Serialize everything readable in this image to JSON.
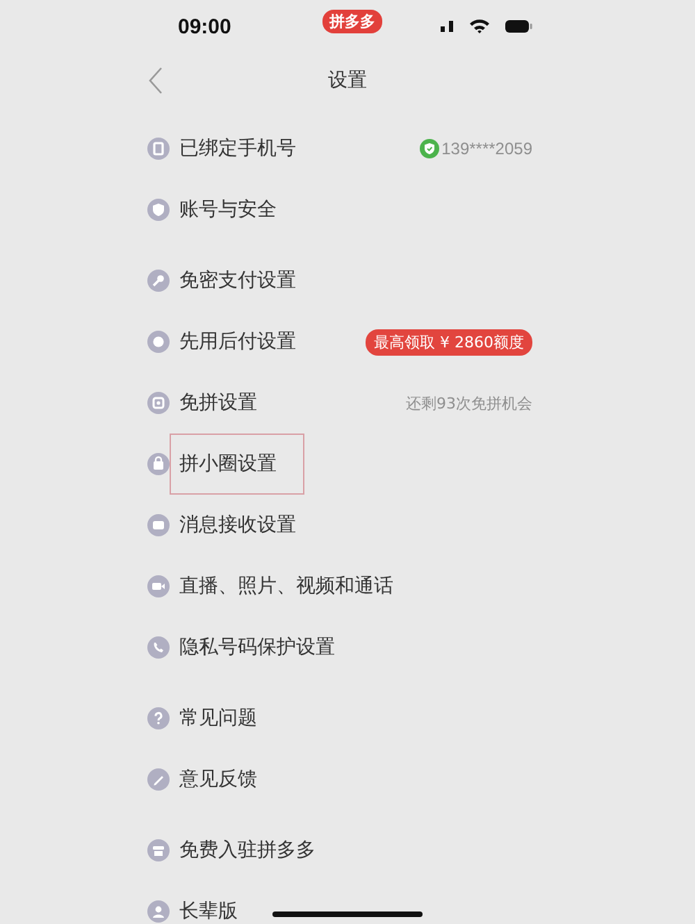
{
  "status_bar": {
    "time": "09:00",
    "app_badge": "拼多多"
  },
  "nav": {
    "title": "设置"
  },
  "sections": [
    {
      "items": [
        {
          "label": "已绑定手机号",
          "value": "139****2059",
          "highlighted": false
        },
        {
          "label": "账号与安全",
          "highlighted": false
        }
      ]
    },
    {
      "items": [
        {
          "label": "免密支付设置",
          "highlighted": false
        },
        {
          "label": "先用后付设置",
          "badge": "最高领取 ¥ 2860额度",
          "highlighted": false
        },
        {
          "label": "免拼设置",
          "hint": "还剩93次免拼机会",
          "highlighted": false
        },
        {
          "label": "拼小圈设置",
          "highlighted": true
        },
        {
          "label": "消息接收设置",
          "highlighted": false
        },
        {
          "label": "直播、照片、视频和通话",
          "highlighted": false
        },
        {
          "label": "隐私号码保护设置",
          "highlighted": false
        }
      ]
    },
    {
      "items": [
        {
          "label": "常见问题",
          "highlighted": false
        },
        {
          "label": "意见反馈",
          "highlighted": false
        }
      ]
    },
    {
      "items": [
        {
          "label": "免费入驻拼多多",
          "highlighted": false
        },
        {
          "label": "长辈版",
          "highlighted": false
        }
      ]
    }
  ]
}
